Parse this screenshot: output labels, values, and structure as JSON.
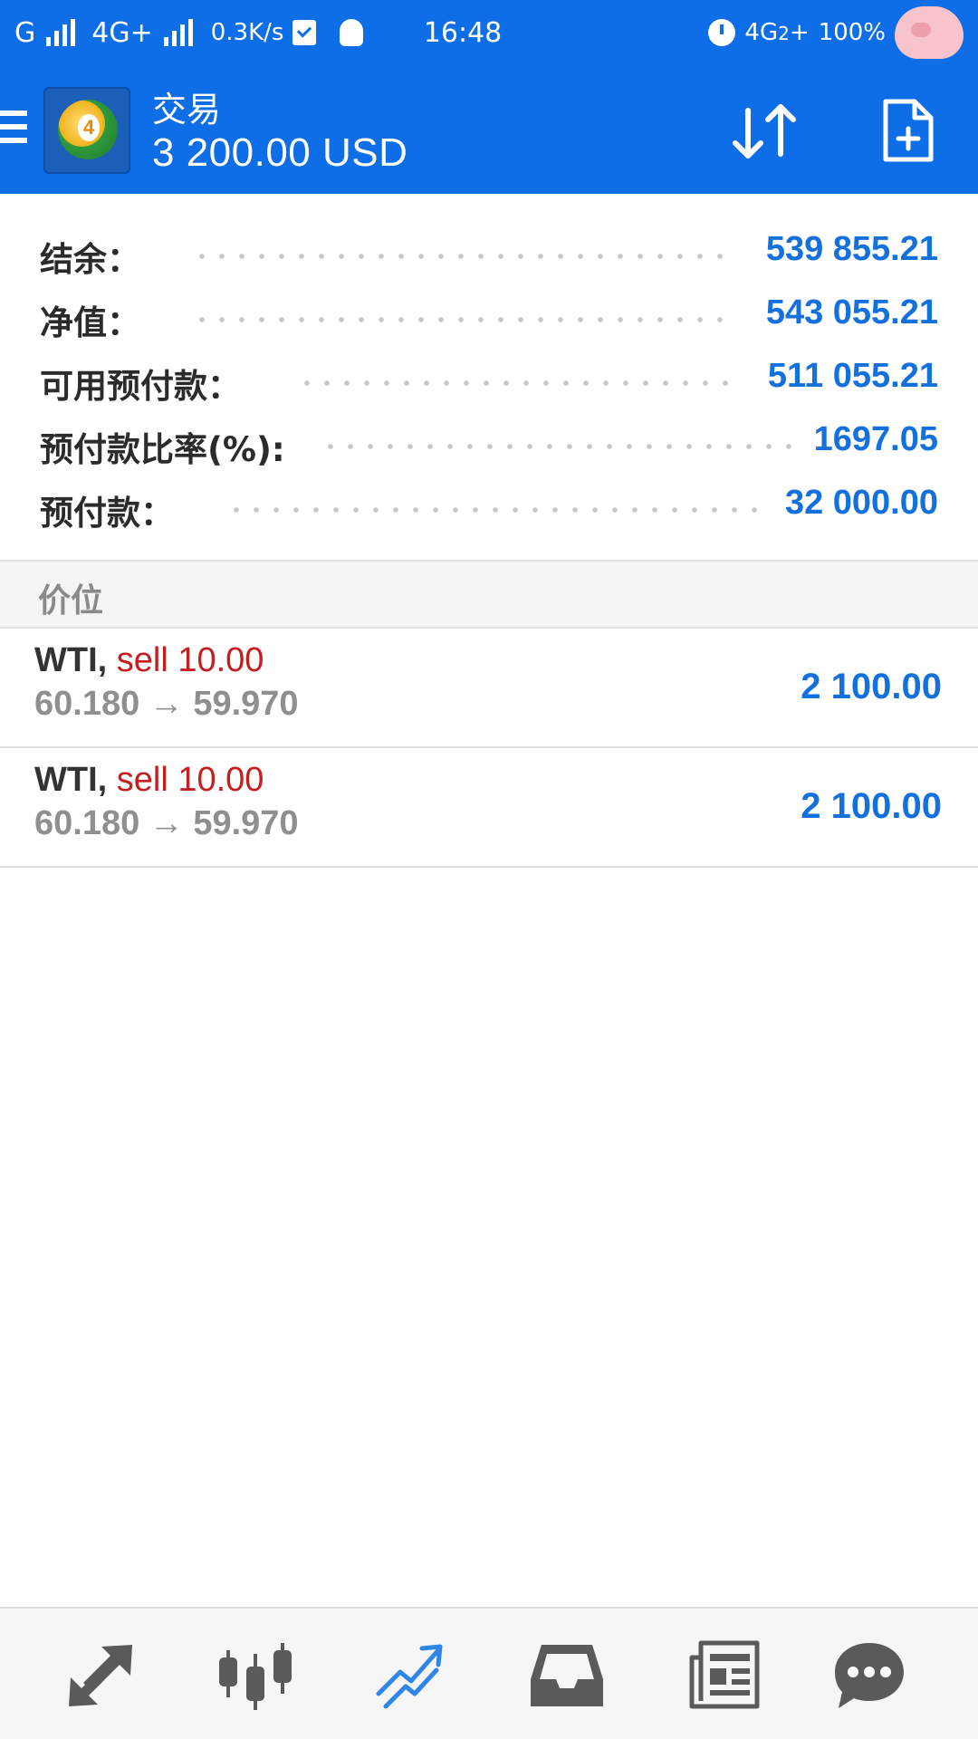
{
  "status_bar": {
    "left_text_1": "G",
    "left_text_2": "4G+",
    "speed": "0.3K/s",
    "time": "16:48",
    "network_right": "4G",
    "network_right_sub": "2",
    "network_right_plus": "+",
    "battery": "100%"
  },
  "app_bar": {
    "title": "交易",
    "balance": "3 200.00 USD",
    "accent_color": "#0d6ee8"
  },
  "summary": {
    "rows": [
      {
        "label": "结余：",
        "value": "539 855.21"
      },
      {
        "label": "净值：",
        "value": "543 055.21"
      },
      {
        "label": "可用预付款：",
        "value": "511 055.21"
      },
      {
        "label": "预付款比率(%):",
        "value": "1697.05"
      },
      {
        "label": "预付款：",
        "value": "32 000.00"
      }
    ]
  },
  "section": {
    "title": "价位"
  },
  "positions": [
    {
      "symbol": "WTI,",
      "type": "sell 10.00",
      "prices": "60.180 → 59.970",
      "profit": "2 100.00"
    },
    {
      "symbol": "WTI,",
      "type": "sell 10.00",
      "prices": "60.180 → 59.970",
      "profit": "2 100.00"
    }
  ],
  "bottom_nav": {
    "items": [
      {
        "icon": "quotes-arrows-icon",
        "active": false
      },
      {
        "icon": "candlestick-chart-icon",
        "active": false
      },
      {
        "icon": "trade-trend-icon",
        "active": true
      },
      {
        "icon": "history-inbox-icon",
        "active": false
      },
      {
        "icon": "news-icon",
        "active": false
      },
      {
        "icon": "chat-icon",
        "active": false
      }
    ],
    "active_color": "#2f86e6",
    "inactive_color": "#5a5a5a"
  }
}
